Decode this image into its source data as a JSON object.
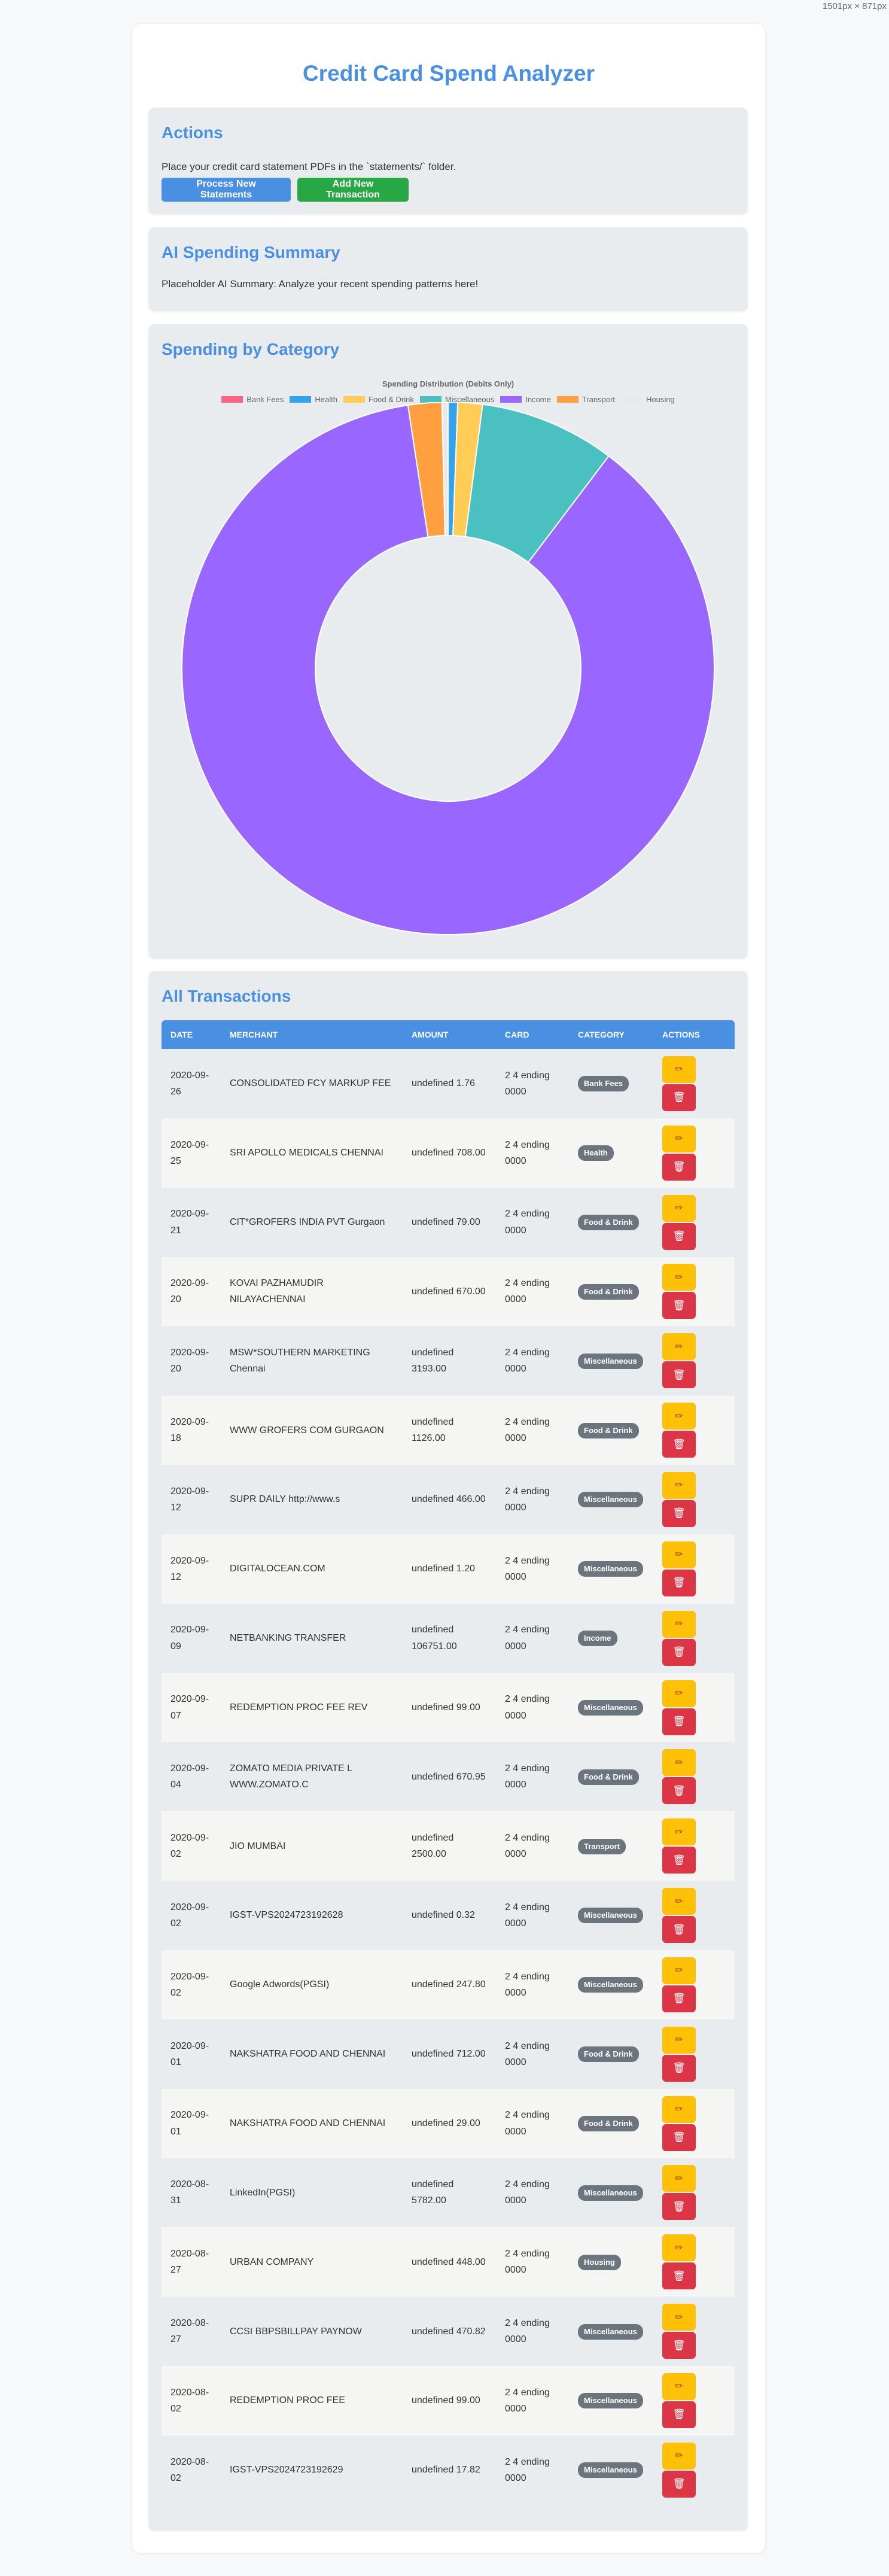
{
  "viewport_label": "1501px × 871px",
  "title": "Credit Card Spend Analyzer",
  "actions": {
    "heading": "Actions",
    "description": "Place your credit card statement PDFs in the `statements/` folder.",
    "process_label": "Process New Statements",
    "add_label": "Add New Transaction"
  },
  "summary": {
    "heading": "AI Spending Summary",
    "text": "Placeholder AI Summary: Analyze your recent spending patterns here!"
  },
  "category_panel": {
    "heading": "Spending by Category"
  },
  "chart_data": {
    "type": "pie",
    "variant": "doughnut",
    "title": "Spending Distribution (Debits Only)",
    "legend_position": "top",
    "categories": [
      "Bank Fees",
      "Health",
      "Food & Drink",
      "Miscellaneous",
      "Income",
      "Transport",
      "Housing"
    ],
    "values": [
      1.76,
      708.0,
      1828.95,
      10071.7,
      106751.0,
      2500.0,
      448.0
    ],
    "colors": [
      "#ff6384",
      "#36a2eb",
      "#ffcd56",
      "#4bc0c0",
      "#9966ff",
      "#ff9f40",
      "#e7e9ed"
    ]
  },
  "transactions": {
    "heading": "All Transactions",
    "columns": [
      "DATE",
      "MERCHANT",
      "AMOUNT",
      "CARD",
      "CATEGORY",
      "ACTIONS"
    ],
    "edit_icon": "pencil-icon",
    "delete_icon": "trash-icon",
    "rows": [
      {
        "date": "2020-09-26",
        "merchant": "CONSOLIDATED FCY MARKUP FEE",
        "amount": "undefined 1.76",
        "card": "2 4 ending 0000",
        "category": "Bank Fees"
      },
      {
        "date": "2020-09-25",
        "merchant": "SRI APOLLO MEDICALS CHENNAI",
        "amount": "undefined 708.00",
        "card": "2 4 ending 0000",
        "category": "Health"
      },
      {
        "date": "2020-09-21",
        "merchant": "CIT*GROFERS INDIA PVT Gurgaon",
        "amount": "undefined 79.00",
        "card": "2 4 ending 0000",
        "category": "Food & Drink"
      },
      {
        "date": "2020-09-20",
        "merchant": "KOVAI PAZHAMUDIR NILAYACHENNAI",
        "amount": "undefined 670.00",
        "card": "2 4 ending 0000",
        "category": "Food & Drink"
      },
      {
        "date": "2020-09-20",
        "merchant": "MSW*SOUTHERN MARKETING Chennai",
        "amount": "undefined 3193.00",
        "card": "2 4 ending 0000",
        "category": "Miscellaneous"
      },
      {
        "date": "2020-09-18",
        "merchant": "WWW GROFERS COM GURGAON",
        "amount": "undefined 1126.00",
        "card": "2 4 ending 0000",
        "category": "Food & Drink"
      },
      {
        "date": "2020-09-12",
        "merchant": "SUPR DAILY http://www.s",
        "amount": "undefined 466.00",
        "card": "2 4 ending 0000",
        "category": "Miscellaneous"
      },
      {
        "date": "2020-09-12",
        "merchant": "DIGITALOCEAN.COM",
        "amount": "undefined 1.20",
        "card": "2 4 ending 0000",
        "category": "Miscellaneous"
      },
      {
        "date": "2020-09-09",
        "merchant": "NETBANKING TRANSFER",
        "amount": "undefined 106751.00",
        "card": "2 4 ending 0000",
        "category": "Income"
      },
      {
        "date": "2020-09-07",
        "merchant": "REDEMPTION PROC FEE REV",
        "amount": "undefined 99.00",
        "card": "2 4 ending 0000",
        "category": "Miscellaneous"
      },
      {
        "date": "2020-09-04",
        "merchant": "ZOMATO MEDIA PRIVATE L WWW.ZOMATO.C",
        "amount": "undefined 670.95",
        "card": "2 4 ending 0000",
        "category": "Food & Drink"
      },
      {
        "date": "2020-09-02",
        "merchant": "JIO MUMBAI",
        "amount": "undefined 2500.00",
        "card": "2 4 ending 0000",
        "category": "Transport"
      },
      {
        "date": "2020-09-02",
        "merchant": "IGST-VPS2024723192628",
        "amount": "undefined 0.32",
        "card": "2 4 ending 0000",
        "category": "Miscellaneous"
      },
      {
        "date": "2020-09-02",
        "merchant": "Google Adwords(PGSI)",
        "amount": "undefined 247.80",
        "card": "2 4 ending 0000",
        "category": "Miscellaneous"
      },
      {
        "date": "2020-09-01",
        "merchant": "NAKSHATRA FOOD AND CHENNAI",
        "amount": "undefined 712.00",
        "card": "2 4 ending 0000",
        "category": "Food & Drink"
      },
      {
        "date": "2020-09-01",
        "merchant": "NAKSHATRA FOOD AND CHENNAI",
        "amount": "undefined 29.00",
        "card": "2 4 ending 0000",
        "category": "Food & Drink"
      },
      {
        "date": "2020-08-31",
        "merchant": "LinkedIn(PGSI)",
        "amount": "undefined 5782.00",
        "card": "2 4 ending 0000",
        "category": "Miscellaneous"
      },
      {
        "date": "2020-08-27",
        "merchant": "URBAN COMPANY",
        "amount": "undefined 448.00",
        "card": "2 4 ending 0000",
        "category": "Housing"
      },
      {
        "date": "2020-08-27",
        "merchant": "CCSI BBPSBILLPAY PAYNOW",
        "amount": "undefined 470.82",
        "card": "2 4 ending 0000",
        "category": "Miscellaneous"
      },
      {
        "date": "2020-08-02",
        "merchant": "REDEMPTION PROC FEE",
        "amount": "undefined 99.00",
        "card": "2 4 ending 0000",
        "category": "Miscellaneous"
      },
      {
        "date": "2020-08-02",
        "merchant": "IGST-VPS2024723192629",
        "amount": "undefined 17.82",
        "card": "2 4 ending 0000",
        "category": "Miscellaneous"
      }
    ]
  }
}
